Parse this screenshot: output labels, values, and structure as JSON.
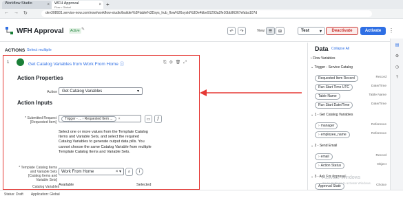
{
  "browser": {
    "tab1_title": "Workflow Studio",
    "tab2_title": "WFH Approval",
    "tab2_sub": "Flow • Global",
    "url": "dev308931.service-now.com/now/workflow-studio/builder%3Ftable%3Dsys_hub_flow%26sysId%3De4bbe91293a2fe10bb96367efaba107d"
  },
  "header": {
    "title": "WFH Approval",
    "badge": "Active",
    "view_label": "View:",
    "test_label": "Test",
    "deactivate_label": "Deactivate",
    "activate_label": "Activate"
  },
  "actions_bar": {
    "label": "ACTIONS",
    "select_multiple": "Select multiple"
  },
  "card": {
    "step_number": "1",
    "title": "Get Catalog Variables from Work From Home",
    "action_properties": "Action Properties",
    "action_label": "Action",
    "action_value": "Get Catalog Variables",
    "action_inputs": "Action Inputs",
    "submitted_label": "* Submitted Request [Requested Item]",
    "pill_value": "Trigger - ... › Requested Item ...",
    "help_text": "Select one or more values from the Template Catalog Items and Variable Sets, and select the required Catalog Variables to generate output data pills. You cannot choose the same Catalog Variable from multiple Template Catalog Items and Variable Sets.",
    "template_label": "* Template Catalog Items and Variable Sets [Catalog Items and Variable Sets]",
    "template_value": "Work From Home",
    "catalog_variables_label": "Catalog Variables",
    "available_label": "Available",
    "selected_label": "Selected"
  },
  "data_panel": {
    "title": "Data",
    "collapse_all": "Collapse All",
    "groups": [
      {
        "label": "Flow Variables",
        "pills": []
      },
      {
        "label": "Trigger - Service Catalog",
        "pills": [
          {
            "name": "Requested Item Record",
            "type": "Record"
          },
          {
            "name": "Run Start Time UTC",
            "type": "Date/Time"
          },
          {
            "name": "Table Name",
            "type": "Table Name"
          },
          {
            "name": "Run Start Date/Time",
            "type": "Date/Time"
          }
        ]
      },
      {
        "label": "1 - Get Catalog Variables",
        "pills": [
          {
            "name": "manager",
            "type": "Reference"
          },
          {
            "name": "employee_name",
            "type": "Reference"
          }
        ]
      },
      {
        "label": "2 - Send Email",
        "pills": [
          {
            "name": "email",
            "type": "Record"
          },
          {
            "name": "Action Status",
            "type": "Object"
          }
        ]
      },
      {
        "label": "3 - Ask For Approval",
        "pills": [
          {
            "name": "Approval State",
            "type": "Choice"
          }
        ]
      }
    ]
  },
  "status_bar": {
    "status": "Status: Draft",
    "application": "Application: Global"
  },
  "watermark": {
    "line1": "Activate Windows",
    "line2": "Go to Settings to activate Windows."
  },
  "colors": {
    "accent": "#2f6fe4",
    "danger": "#e53935",
    "success": "#1a7f37"
  }
}
